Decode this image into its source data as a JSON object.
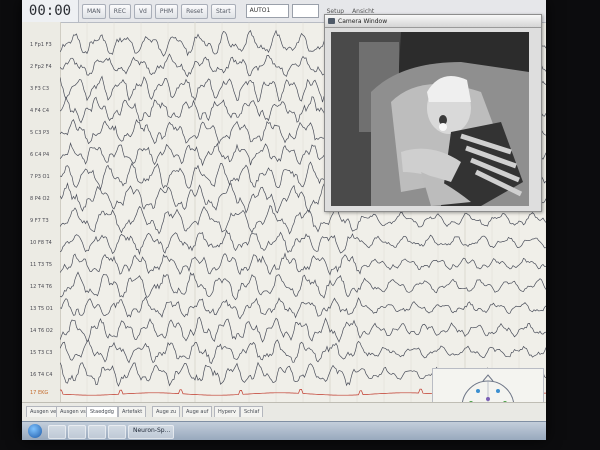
{
  "toolbar": {
    "timer": "00:00",
    "buttons": [
      "MAN",
      "REC",
      "Vd",
      "PHM",
      "Reset",
      "Start"
    ],
    "select_value": "AUTO1",
    "menu_items": [
      "Setup",
      "Ansicht"
    ]
  },
  "channels": [
    "1 Fp1 F3",
    "2 Fp2 F4",
    "3 F3 C3",
    "4 F4 C4",
    "5 C3 P3",
    "6 C4 P4",
    "7 P3 O1",
    "8 P4 O2",
    "9 F7 T3",
    "10 F8 T4",
    "11 T3 T5",
    "12 T4 T6",
    "13 T5 O1",
    "14 T6 O2",
    "15 T3 C3",
    "16 T4 C4",
    "17 EKG"
  ],
  "camera_window": {
    "title": "Camera Window"
  },
  "footer": {
    "tabs": [
      "Ausgen ver",
      "Ausgen vs",
      "Staedgdg",
      "Artefakt",
      "Auge zu",
      "Auge auf",
      "Hyperv",
      "Schlaf"
    ]
  },
  "taskbar": {
    "items": [
      "",
      "",
      "",
      "",
      "Neuron-Sp..."
    ]
  },
  "colors": {
    "trace": "#4a4e5a",
    "ekg": "#c0392b",
    "grid": "#d8d6cc"
  }
}
